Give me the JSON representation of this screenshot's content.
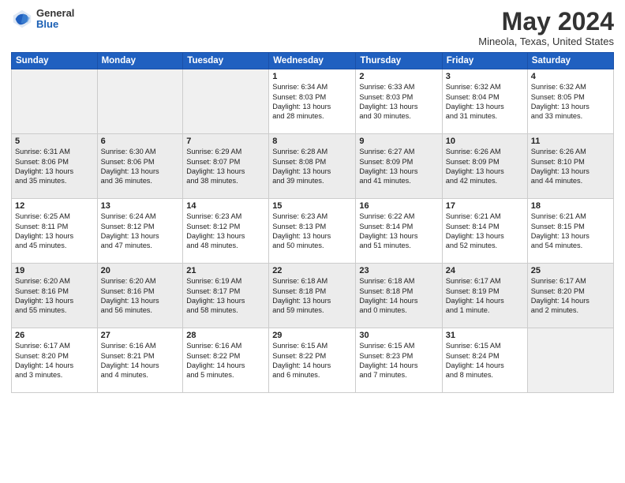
{
  "logo": {
    "general": "General",
    "blue": "Blue"
  },
  "header": {
    "title": "May 2024",
    "subtitle": "Mineola, Texas, United States"
  },
  "weekdays": [
    "Sunday",
    "Monday",
    "Tuesday",
    "Wednesday",
    "Thursday",
    "Friday",
    "Saturday"
  ],
  "weeks": [
    [
      {
        "day": "",
        "info": ""
      },
      {
        "day": "",
        "info": ""
      },
      {
        "day": "",
        "info": ""
      },
      {
        "day": "1",
        "info": "Sunrise: 6:34 AM\nSunset: 8:03 PM\nDaylight: 13 hours\nand 28 minutes."
      },
      {
        "day": "2",
        "info": "Sunrise: 6:33 AM\nSunset: 8:03 PM\nDaylight: 13 hours\nand 30 minutes."
      },
      {
        "day": "3",
        "info": "Sunrise: 6:32 AM\nSunset: 8:04 PM\nDaylight: 13 hours\nand 31 minutes."
      },
      {
        "day": "4",
        "info": "Sunrise: 6:32 AM\nSunset: 8:05 PM\nDaylight: 13 hours\nand 33 minutes."
      }
    ],
    [
      {
        "day": "5",
        "info": "Sunrise: 6:31 AM\nSunset: 8:06 PM\nDaylight: 13 hours\nand 35 minutes."
      },
      {
        "day": "6",
        "info": "Sunrise: 6:30 AM\nSunset: 8:06 PM\nDaylight: 13 hours\nand 36 minutes."
      },
      {
        "day": "7",
        "info": "Sunrise: 6:29 AM\nSunset: 8:07 PM\nDaylight: 13 hours\nand 38 minutes."
      },
      {
        "day": "8",
        "info": "Sunrise: 6:28 AM\nSunset: 8:08 PM\nDaylight: 13 hours\nand 39 minutes."
      },
      {
        "day": "9",
        "info": "Sunrise: 6:27 AM\nSunset: 8:09 PM\nDaylight: 13 hours\nand 41 minutes."
      },
      {
        "day": "10",
        "info": "Sunrise: 6:26 AM\nSunset: 8:09 PM\nDaylight: 13 hours\nand 42 minutes."
      },
      {
        "day": "11",
        "info": "Sunrise: 6:26 AM\nSunset: 8:10 PM\nDaylight: 13 hours\nand 44 minutes."
      }
    ],
    [
      {
        "day": "12",
        "info": "Sunrise: 6:25 AM\nSunset: 8:11 PM\nDaylight: 13 hours\nand 45 minutes."
      },
      {
        "day": "13",
        "info": "Sunrise: 6:24 AM\nSunset: 8:12 PM\nDaylight: 13 hours\nand 47 minutes."
      },
      {
        "day": "14",
        "info": "Sunrise: 6:23 AM\nSunset: 8:12 PM\nDaylight: 13 hours\nand 48 minutes."
      },
      {
        "day": "15",
        "info": "Sunrise: 6:23 AM\nSunset: 8:13 PM\nDaylight: 13 hours\nand 50 minutes."
      },
      {
        "day": "16",
        "info": "Sunrise: 6:22 AM\nSunset: 8:14 PM\nDaylight: 13 hours\nand 51 minutes."
      },
      {
        "day": "17",
        "info": "Sunrise: 6:21 AM\nSunset: 8:14 PM\nDaylight: 13 hours\nand 52 minutes."
      },
      {
        "day": "18",
        "info": "Sunrise: 6:21 AM\nSunset: 8:15 PM\nDaylight: 13 hours\nand 54 minutes."
      }
    ],
    [
      {
        "day": "19",
        "info": "Sunrise: 6:20 AM\nSunset: 8:16 PM\nDaylight: 13 hours\nand 55 minutes."
      },
      {
        "day": "20",
        "info": "Sunrise: 6:20 AM\nSunset: 8:16 PM\nDaylight: 13 hours\nand 56 minutes."
      },
      {
        "day": "21",
        "info": "Sunrise: 6:19 AM\nSunset: 8:17 PM\nDaylight: 13 hours\nand 58 minutes."
      },
      {
        "day": "22",
        "info": "Sunrise: 6:18 AM\nSunset: 8:18 PM\nDaylight: 13 hours\nand 59 minutes."
      },
      {
        "day": "23",
        "info": "Sunrise: 6:18 AM\nSunset: 8:18 PM\nDaylight: 14 hours\nand 0 minutes."
      },
      {
        "day": "24",
        "info": "Sunrise: 6:17 AM\nSunset: 8:19 PM\nDaylight: 14 hours\nand 1 minute."
      },
      {
        "day": "25",
        "info": "Sunrise: 6:17 AM\nSunset: 8:20 PM\nDaylight: 14 hours\nand 2 minutes."
      }
    ],
    [
      {
        "day": "26",
        "info": "Sunrise: 6:17 AM\nSunset: 8:20 PM\nDaylight: 14 hours\nand 3 minutes."
      },
      {
        "day": "27",
        "info": "Sunrise: 6:16 AM\nSunset: 8:21 PM\nDaylight: 14 hours\nand 4 minutes."
      },
      {
        "day": "28",
        "info": "Sunrise: 6:16 AM\nSunset: 8:22 PM\nDaylight: 14 hours\nand 5 minutes."
      },
      {
        "day": "29",
        "info": "Sunrise: 6:15 AM\nSunset: 8:22 PM\nDaylight: 14 hours\nand 6 minutes."
      },
      {
        "day": "30",
        "info": "Sunrise: 6:15 AM\nSunset: 8:23 PM\nDaylight: 14 hours\nand 7 minutes."
      },
      {
        "day": "31",
        "info": "Sunrise: 6:15 AM\nSunset: 8:24 PM\nDaylight: 14 hours\nand 8 minutes."
      },
      {
        "day": "",
        "info": ""
      }
    ]
  ],
  "shaded_rows": [
    1,
    3
  ]
}
